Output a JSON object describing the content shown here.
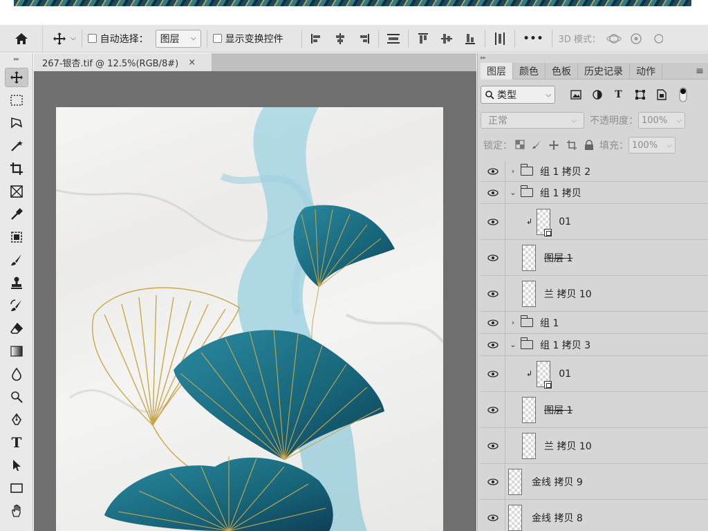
{
  "options_bar": {
    "auto_select_label": "自动选择：",
    "auto_select_target": "图层",
    "show_transform_label": "显示变换控件",
    "more_label": "•••",
    "mode_3d_label": "3D 模式："
  },
  "document": {
    "tab_title": "267-银杏.tif @ 12.5%(RGB/8#)",
    "close_glyph": "×"
  },
  "layers_panel": {
    "tabs": [
      "图层",
      "颜色",
      "色板",
      "历史记录",
      "动作"
    ],
    "filter_kind": "类型",
    "blend_mode": "正常",
    "opacity_label": "不透明度：",
    "opacity_value": "100%",
    "lock_label": "锁定：",
    "fill_label": "填充：",
    "fill_value": "100%",
    "layers": [
      {
        "name": "组 1 拷贝 2",
        "kind": "group",
        "expanded": false
      },
      {
        "name": "组 1 拷贝",
        "kind": "group",
        "expanded": true
      },
      {
        "name": "01",
        "kind": "smart-clipped"
      },
      {
        "name": "图层 1",
        "kind": "layer"
      },
      {
        "name": "兰 拷贝 10",
        "kind": "layer"
      },
      {
        "name": "组 1",
        "kind": "group",
        "expanded": false
      },
      {
        "name": "组 1 拷贝 3",
        "kind": "group",
        "expanded": true
      },
      {
        "name": "01",
        "kind": "smart-clipped"
      },
      {
        "name": "图层 1",
        "kind": "layer"
      },
      {
        "name": "兰 拷贝 10",
        "kind": "layer"
      },
      {
        "name": "金线 拷贝 9",
        "kind": "layer"
      },
      {
        "name": "金线 拷贝 8",
        "kind": "layer"
      }
    ]
  },
  "colors": {
    "teal": "#1f6f86",
    "gold": "#c9a94e",
    "ribbon": "#8ec9d9"
  }
}
